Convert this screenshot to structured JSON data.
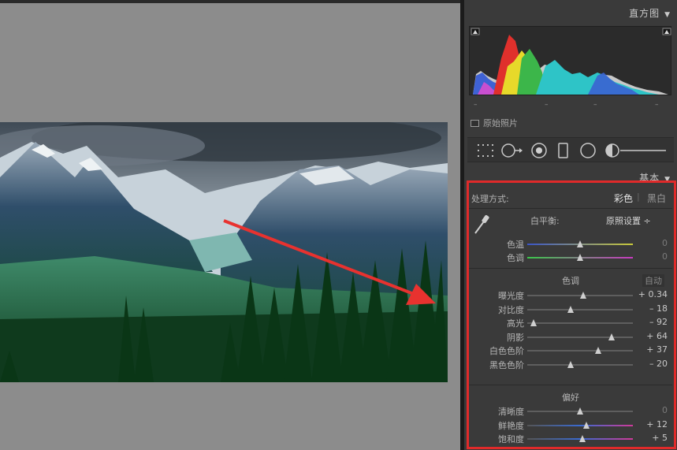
{
  "right_panel": {
    "histogram": {
      "title": "直方图",
      "original_photo_label": "原始照片"
    },
    "basic": {
      "title": "基本",
      "treatment": {
        "label": "处理方式:",
        "color": "彩色",
        "divider": "|",
        "bw": "黑白"
      },
      "white_balance": {
        "label": "白平衡:",
        "preset": "原照设置 ÷"
      },
      "wb_sliders": [
        {
          "label": "色温",
          "value": "0",
          "fraction": 0.5
        },
        {
          "label": "色调",
          "value": "0",
          "fraction": 0.5
        }
      ],
      "tone": {
        "title": "色调",
        "auto": "自动"
      },
      "tone_sliders": [
        {
          "label": "曝光度",
          "value": "+ 0.34",
          "fraction": 0.53
        },
        {
          "label": "对比度",
          "value": "– 18",
          "fraction": 0.41
        },
        {
          "label": "高光",
          "value": "– 92",
          "fraction": 0.06
        },
        {
          "label": "阴影",
          "value": "+ 64",
          "fraction": 0.8
        },
        {
          "label": "白色色阶",
          "value": "+ 37",
          "fraction": 0.67
        },
        {
          "label": "黑色色阶",
          "value": "– 20",
          "fraction": 0.41
        }
      ],
      "presence": {
        "title": "偏好"
      },
      "presence_sliders": [
        {
          "label": "清晰度",
          "value": "0",
          "fraction": 0.5
        },
        {
          "label": "鲜艳度",
          "value": "+ 12",
          "fraction": 0.56
        },
        {
          "label": "饱和度",
          "value": "+ 5",
          "fraction": 0.52
        }
      ]
    }
  },
  "colors": {
    "highlight": "#e02a2a",
    "arrow": "#e8322f",
    "panel_bg": "#3a3a3a"
  },
  "icons": [
    "triangle-down-icon",
    "eyedropper-icon",
    "crop-grid-icon",
    "spot-removal-icon",
    "red-eye-icon",
    "graduated-filter-icon",
    "radial-filter-icon",
    "adjustment-brush-icon"
  ]
}
